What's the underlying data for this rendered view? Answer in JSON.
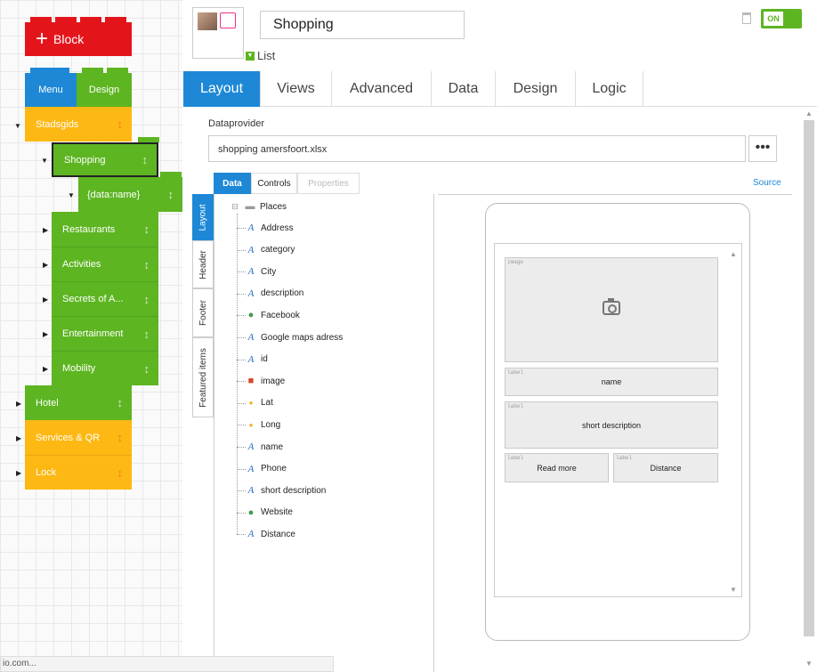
{
  "left": {
    "block_label": "Block",
    "menu_label": "Menu",
    "design_label": "Design",
    "tree": [
      {
        "label": "Stadsgids",
        "color": "#fdb813"
      },
      {
        "label": "Shopping",
        "color": "#5db521"
      },
      {
        "label": "{data:name}",
        "color": "#5db521"
      },
      {
        "label": "Restaurants",
        "color": "#5db521"
      },
      {
        "label": "Activities",
        "color": "#5db521"
      },
      {
        "label": "Secrets of A...",
        "color": "#5db521"
      },
      {
        "label": "Entertainment",
        "color": "#5db521"
      },
      {
        "label": "Mobility",
        "color": "#5db521"
      },
      {
        "label": "Hotel",
        "color": "#5db521"
      },
      {
        "label": "Services & QR",
        "color": "#fdb813"
      },
      {
        "label": "Lock",
        "color": "#fdb813"
      }
    ]
  },
  "header": {
    "title": "Shopping",
    "type_label": "List",
    "toggle_label": "ON"
  },
  "tabs": [
    "Layout",
    "Views",
    "Advanced",
    "Data",
    "Design",
    "Logic"
  ],
  "dataprovider": {
    "label": "Dataprovider",
    "value": "shopping amersfoort.xlsx",
    "button": "•••"
  },
  "subtabs": [
    "Data",
    "Controls",
    "Properties"
  ],
  "source_label": "Source",
  "vtabs": [
    "Layout",
    "Header",
    "Footer",
    "Featured items"
  ],
  "fields_root": "Places",
  "fields": [
    {
      "label": "Address",
      "icon": "text-icon"
    },
    {
      "label": "category",
      "icon": "text-icon"
    },
    {
      "label": "City",
      "icon": "text-icon"
    },
    {
      "label": "description",
      "icon": "text-icon"
    },
    {
      "label": "Facebook",
      "icon": "globe-icon"
    },
    {
      "label": "Google maps adress",
      "icon": "text-icon"
    },
    {
      "label": "id",
      "icon": "text-icon"
    },
    {
      "label": "image",
      "icon": "image-icon"
    },
    {
      "label": "Lat",
      "icon": "pin-icon"
    },
    {
      "label": "Long",
      "icon": "pin-icon"
    },
    {
      "label": "name",
      "icon": "text-icon"
    },
    {
      "label": "Phone",
      "icon": "text-icon"
    },
    {
      "label": "short description",
      "icon": "text-icon"
    },
    {
      "label": "Website",
      "icon": "globe-icon"
    },
    {
      "label": "Distance",
      "icon": "text-icon"
    }
  ],
  "preview": {
    "image_tag": "image",
    "label_tag": "label",
    "name": "name",
    "short_description": "short description",
    "read_more": "Read more",
    "distance": "Distance"
  },
  "status": "io.com...",
  "colors": {
    "accent": "#1e88d6",
    "green": "#5db521",
    "orange": "#fdb813",
    "red": "#e3151b"
  }
}
